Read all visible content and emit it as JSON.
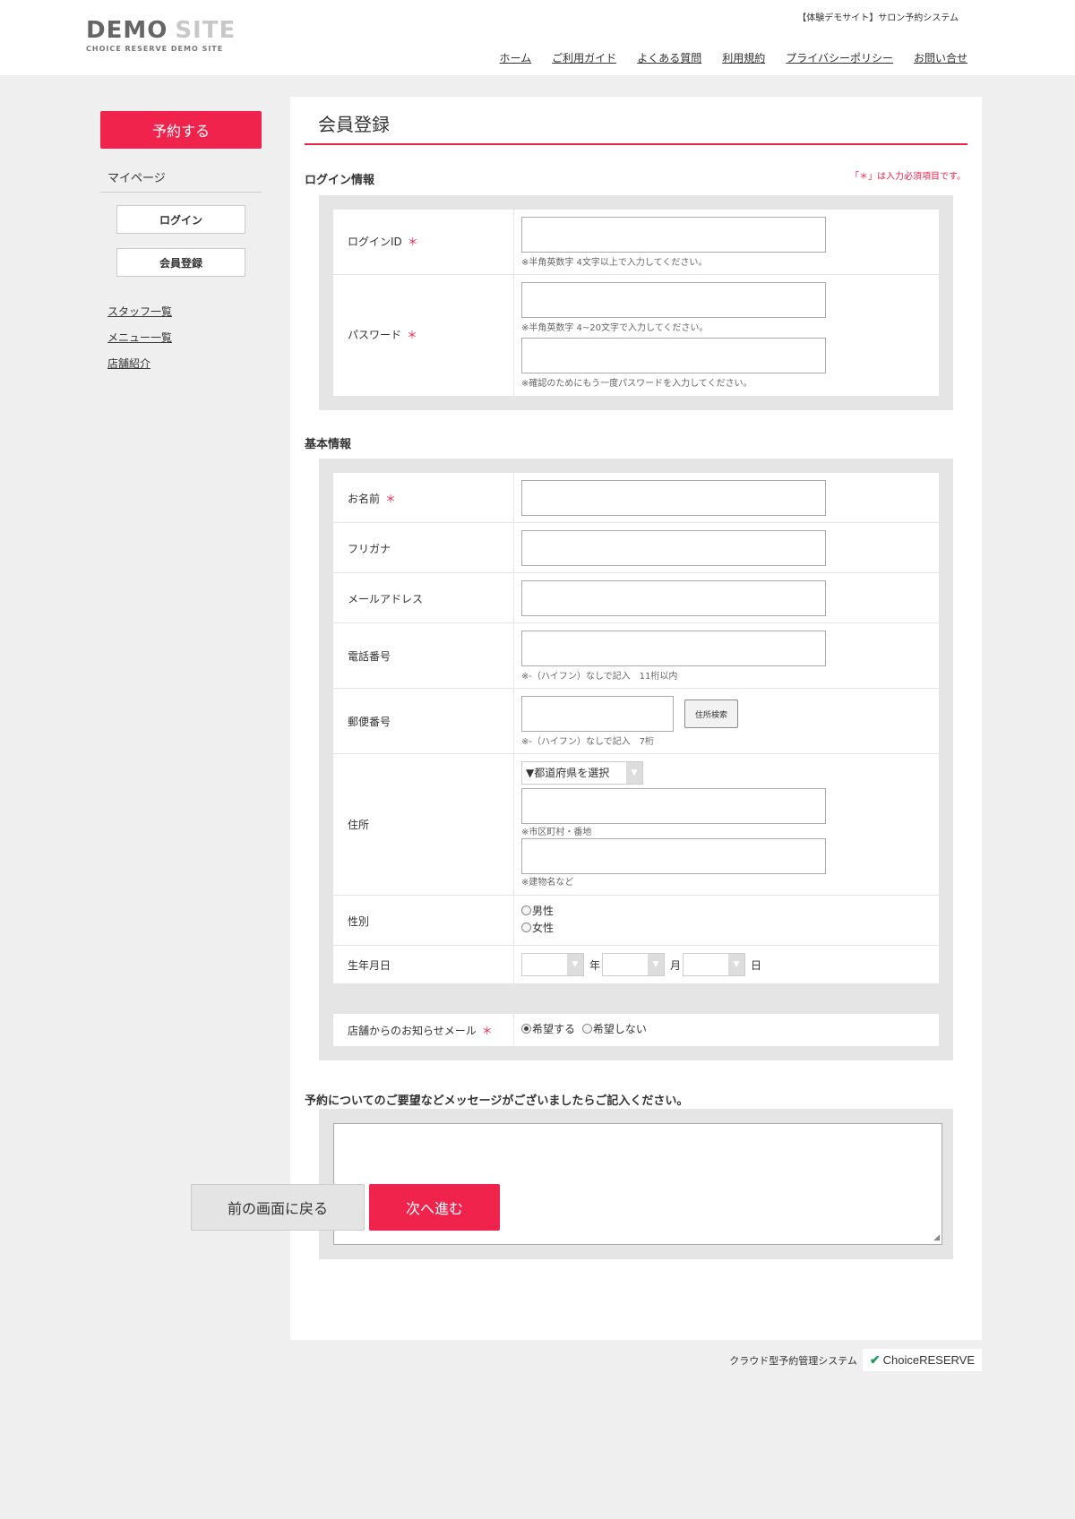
{
  "header": {
    "logo_main_a": "DEMO",
    "logo_main_b": "SITE",
    "logo_sub": "CHOICE RESERVE DEMO SITE",
    "tagline": "【体験デモサイト】サロン予約システム",
    "nav": [
      "ホーム",
      "ご利用ガイド",
      "よくある質問",
      "利用規約",
      "プライバシーポリシー",
      "お問い合せ"
    ]
  },
  "sidebar": {
    "reserve_label": "予約する",
    "mypage_label": "マイページ",
    "login_label": "ログイン",
    "register_label": "会員登録",
    "links": [
      "スタッフ一覧",
      "メニュー一覧",
      "店舗紹介"
    ]
  },
  "page": {
    "title": "会員登録",
    "required_note": "「＊」は入力必須項目です。"
  },
  "login_section": {
    "title": "ログイン情報",
    "login_id_label": "ログインID",
    "login_id_hint": "※半角英数字 4文字以上で入力してください。",
    "password_label": "パスワード",
    "password_hint": "※半角英数字 4~20文字で入力してください。",
    "password_confirm_hint": "※確認のためにもう一度パスワードを入力してください。"
  },
  "basic_section": {
    "title": "基本情報",
    "name_label": "お名前",
    "kana_label": "フリガナ",
    "email_label": "メールアドレス",
    "phone_label": "電話番号",
    "phone_hint": "※-（ハイフン）なしで記入　11桁以内",
    "zip_label": "郵便番号",
    "zip_search_label": "住所検索",
    "zip_hint": "※-（ハイフン）なしで記入　7桁",
    "address_label": "住所",
    "prefecture_select": "▼都道府県を選択",
    "address_hint1": "※市区町村・番地",
    "address_hint2": "※建物名など",
    "gender_label": "性別",
    "gender_male": "男性",
    "gender_female": "女性",
    "birthday_label": "生年月日",
    "year_unit": "年",
    "month_unit": "月",
    "day_unit": "日",
    "newsletter_label": "店舗からのお知らせメール",
    "newsletter_yes": "希望する",
    "newsletter_no": "希望しない"
  },
  "message_section": {
    "title": "予約についてのご要望などメッセージがございましたらご記入ください。"
  },
  "buttons": {
    "back_label": "前の画面に戻る",
    "next_label": "次へ進む"
  },
  "footer": {
    "system_label": "クラウド型予約管理システム",
    "brand": "ChoiceRESERVE"
  },
  "required_mark": "＊",
  "colors": {
    "accent": "#ef234c",
    "brand_green": "#1e9b5a"
  }
}
